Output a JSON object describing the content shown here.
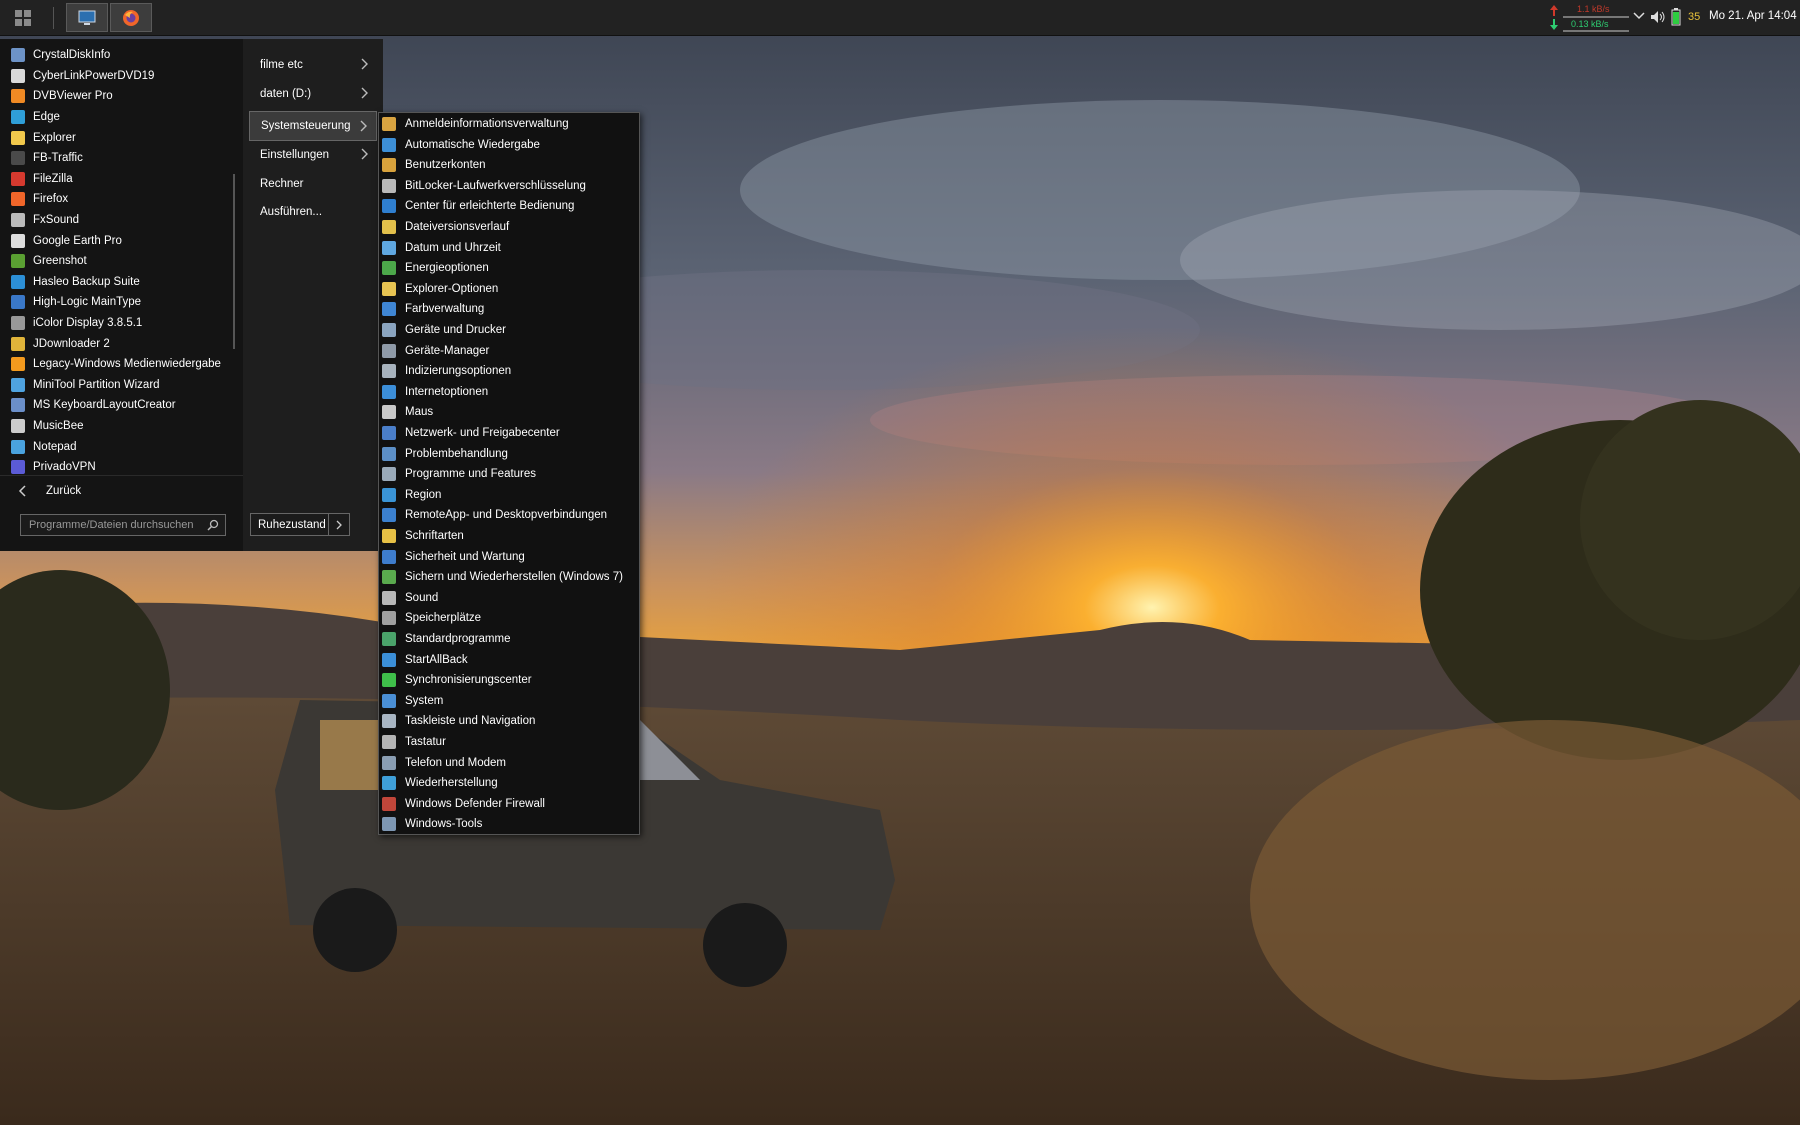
{
  "taskbar": {
    "quick_launch": [
      {
        "name": "show-desktop",
        "icon": "monitor-icon"
      },
      {
        "name": "firefox",
        "icon": "firefox-icon"
      }
    ],
    "tray": {
      "net_up": "1.1 kB/s",
      "net_down": "0.13 kB/s",
      "battery_value": "35",
      "clock": "Mo 21. Apr 14:04"
    }
  },
  "start_menu": {
    "apps": [
      {
        "label": "CrystalDiskInfo",
        "color": "#6d93c7"
      },
      {
        "label": "CyberLinkPowerDVD19",
        "color": "#d9d9d9"
      },
      {
        "label": "DVBViewer Pro",
        "color": "#f08a24"
      },
      {
        "label": "Edge",
        "color": "#2f9fd8"
      },
      {
        "label": "Explorer",
        "color": "#f2c94c"
      },
      {
        "label": "FB-Traffic",
        "color": "#4a4a4a"
      },
      {
        "label": "FileZilla",
        "color": "#d63a2f"
      },
      {
        "label": "Firefox",
        "color": "#f1662a"
      },
      {
        "label": "FxSound",
        "color": "#bbbbbb"
      },
      {
        "label": "Google Earth Pro",
        "color": "#dddddd"
      },
      {
        "label": "Greenshot",
        "color": "#5aa032"
      },
      {
        "label": "Hasleo Backup Suite",
        "color": "#2c8fd6"
      },
      {
        "label": "High-Logic MainType",
        "color": "#3a78c8"
      },
      {
        "label": "iColor Display 3.8.5.1",
        "color": "#999999"
      },
      {
        "label": "JDownloader 2",
        "color": "#e0b43a"
      },
      {
        "label": "Legacy-Windows Medienwiedergabe",
        "color": "#f39a1e"
      },
      {
        "label": "MiniTool Partition Wizard",
        "color": "#4fa3e0"
      },
      {
        "label": "MS KeyboardLayoutCreator",
        "color": "#6b8fc9"
      },
      {
        "label": "MusicBee",
        "color": "#cccccc"
      },
      {
        "label": "Notepad",
        "color": "#4aa3df"
      },
      {
        "label": "PrivadoVPN",
        "color": "#5b5bd6"
      }
    ],
    "right_items": [
      {
        "label": "filme etc",
        "arrow": true
      },
      {
        "label": "daten (D:)",
        "arrow": true
      },
      {
        "label": "Systemsteuerung",
        "arrow": true,
        "selected": true
      },
      {
        "label": "Einstellungen",
        "arrow": true
      },
      {
        "label": "Rechner",
        "arrow": false
      },
      {
        "label": "Ausführen...",
        "arrow": false
      }
    ],
    "back_label": "Zurück",
    "search_placeholder": "Programme/Dateien durchsuchen",
    "power_label": "Ruhezustand"
  },
  "control_panel_items": [
    {
      "label": "Anmeldeinformationsverwaltung",
      "color": "#d9a441"
    },
    {
      "label": "Automatische Wiedergabe",
      "color": "#3d8fd6"
    },
    {
      "label": "Benutzerkonten",
      "color": "#d8a23c"
    },
    {
      "label": "BitLocker-Laufwerkverschlüsselung",
      "color": "#b9b9b9"
    },
    {
      "label": "Center für erleichterte Bedienung",
      "color": "#2f7fd0"
    },
    {
      "label": "Dateiversionsverlauf",
      "color": "#e2c04b"
    },
    {
      "label": "Datum und Uhrzeit",
      "color": "#5fa7e0"
    },
    {
      "label": "Energieoptionen",
      "color": "#4ca84a"
    },
    {
      "label": "Explorer-Optionen",
      "color": "#e8c452"
    },
    {
      "label": "Farbverwaltung",
      "color": "#3f86d4"
    },
    {
      "label": "Geräte und Drucker",
      "color": "#8aa4bf"
    },
    {
      "label": "Geräte-Manager",
      "color": "#8f9aa8"
    },
    {
      "label": "Indizierungsoptionen",
      "color": "#a7b2bd"
    },
    {
      "label": "Internetoptionen",
      "color": "#3c8ed8"
    },
    {
      "label": "Maus",
      "color": "#c8c8c8"
    },
    {
      "label": "Netzwerk- und Freigabecenter",
      "color": "#4a7ec9"
    },
    {
      "label": "Problembehandlung",
      "color": "#5c8fc7"
    },
    {
      "label": "Programme und Features",
      "color": "#9aaab9"
    },
    {
      "label": "Region",
      "color": "#3a94d6"
    },
    {
      "label": "RemoteApp- und Desktopverbindungen",
      "color": "#3b80cf"
    },
    {
      "label": "Schriftarten",
      "color": "#e6c045"
    },
    {
      "label": "Sicherheit und Wartung",
      "color": "#3e7ccc"
    },
    {
      "label": "Sichern und Wiederherstellen (Windows 7)",
      "color": "#5aaa4e"
    },
    {
      "label": "Sound",
      "color": "#b8b8b8"
    },
    {
      "label": "Speicherplätze",
      "color": "#a0a0a0"
    },
    {
      "label": "Standardprogramme",
      "color": "#4aa36a"
    },
    {
      "label": "StartAllBack",
      "color": "#3b8fd8"
    },
    {
      "label": "Synchronisierungscenter",
      "color": "#3fbf4a"
    },
    {
      "label": "System",
      "color": "#4a8fd5"
    },
    {
      "label": "Taskleiste und Navigation",
      "color": "#a9b6c3"
    },
    {
      "label": "Tastatur",
      "color": "#b5b5b5"
    },
    {
      "label": "Telefon und Modem",
      "color": "#8a9eb3"
    },
    {
      "label": "Wiederherstellung",
      "color": "#3f9fd8"
    },
    {
      "label": "Windows Defender Firewall",
      "color": "#c0463a"
    },
    {
      "label": "Windows-Tools",
      "color": "#7e97b3"
    }
  ]
}
